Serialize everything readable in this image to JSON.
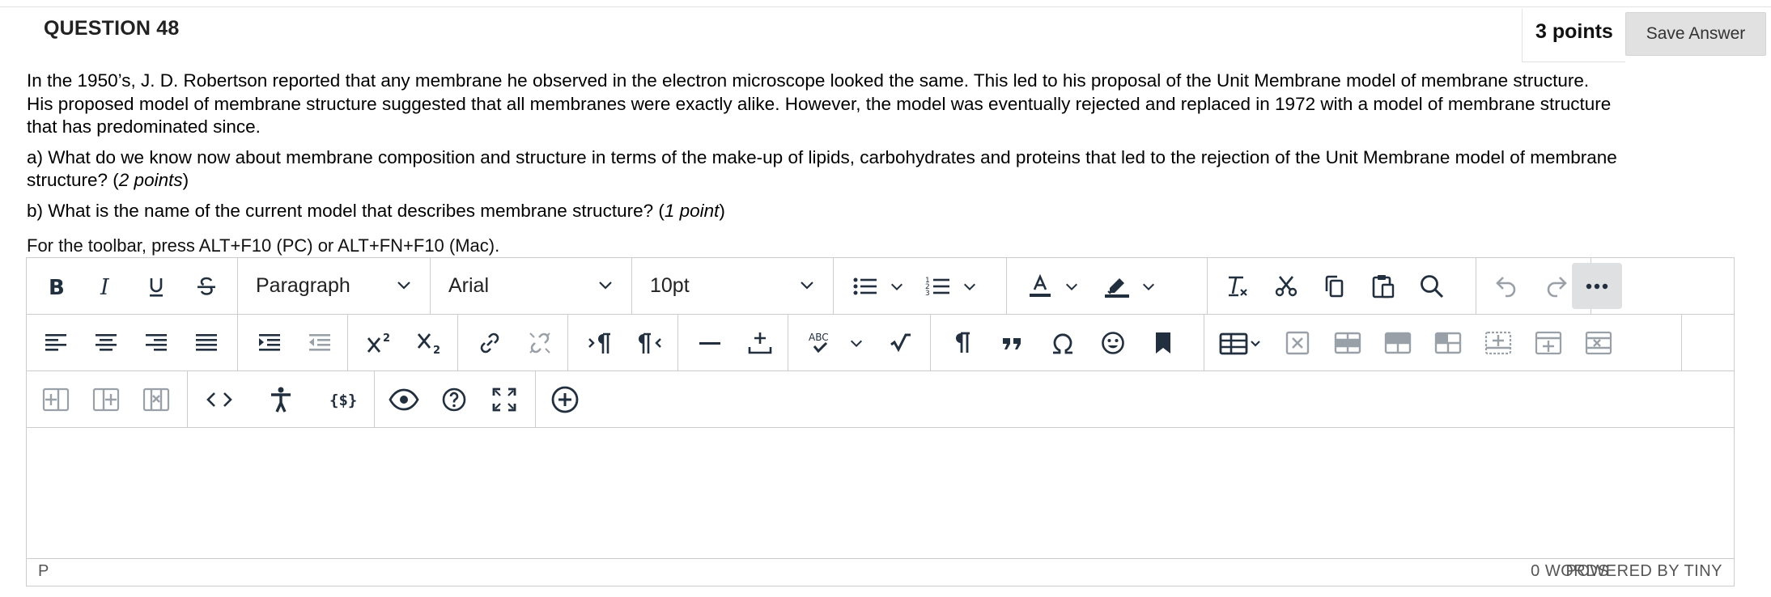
{
  "question": {
    "title": "QUESTION 48",
    "points": "3 points",
    "save_label": "Save Answer",
    "paragraph1_line1": "In the 1950’s, J. D. Robertson reported that any membrane he observed in the electron microscope looked the same.  This led to his proposal of the Unit Membrane model of membrane structure.",
    "paragraph1_line2": "His proposed model of membrane structure suggested that all membranes were exactly alike.  However, the model was eventually rejected and replaced in 1972 with a model of membrane structure",
    "paragraph1_line3": "that has predominated since.",
    "part_a_line1": "a) What do we know now about membrane composition and structure in terms of the make-up of lipids, carbohydrates and proteins that led to the rejection of the Unit Membrane model of membrane",
    "part_a_line2_prefix": "structure? (",
    "part_a_points": "2 points",
    "part_a_suffix": ")",
    "part_b_prefix": "b) What is the name of the current model that describes membrane structure? (",
    "part_b_points": "1 point",
    "part_b_suffix": ")"
  },
  "editor": {
    "toolbar_hint": "For the toolbar, press ALT+F10 (PC) or ALT+FN+F10 (Mac).",
    "block_format": "Paragraph",
    "font_family": "Arial",
    "font_size": "10pt",
    "status_path": "P",
    "word_count": "0 WORDS",
    "powered_by": "POWERED BY TINY",
    "content": ""
  },
  "icons": {
    "row1": [
      "bold-icon",
      "italic-icon",
      "underline-icon",
      "strikethrough-icon",
      "bullet-list-icon",
      "numbered-list-icon",
      "text-color-icon",
      "highlight-icon",
      "clear-formatting-icon",
      "cut-icon",
      "copy-icon",
      "paste-icon",
      "search-icon",
      "undo-icon",
      "redo-icon",
      "more-icon"
    ],
    "row2": [
      "align-left-icon",
      "align-center-icon",
      "align-right-icon",
      "justify-icon",
      "indent-icon",
      "outdent-icon",
      "superscript-icon",
      "subscript-icon",
      "link-icon",
      "unlink-icon",
      "ltr-icon",
      "rtl-icon",
      "horizontal-rule-icon",
      "plus-minus-icon",
      "spellcheck-icon",
      "math-icon",
      "paragraph-mark-icon",
      "blockquote-icon",
      "omega-icon",
      "emoji-icon",
      "bookmark-icon",
      "table-icon",
      "delete-table-icon",
      "row-props-icon",
      "cell-props-icon",
      "merge-cells-icon",
      "insert-row-icon",
      "insert-row-after-icon",
      "delete-row-icon"
    ],
    "row3": [
      "insert-column-before-icon",
      "insert-column-after-icon",
      "delete-column-icon",
      "source-code-icon",
      "accessibility-icon",
      "template-icon",
      "preview-icon",
      "help-icon",
      "fullscreen-icon",
      "add-content-icon"
    ]
  },
  "colors": {
    "save_button_bg": "#e1e1e1",
    "active_button_bg": "#dee0e2",
    "border": "#cccccc",
    "icon": "#222f3e"
  }
}
